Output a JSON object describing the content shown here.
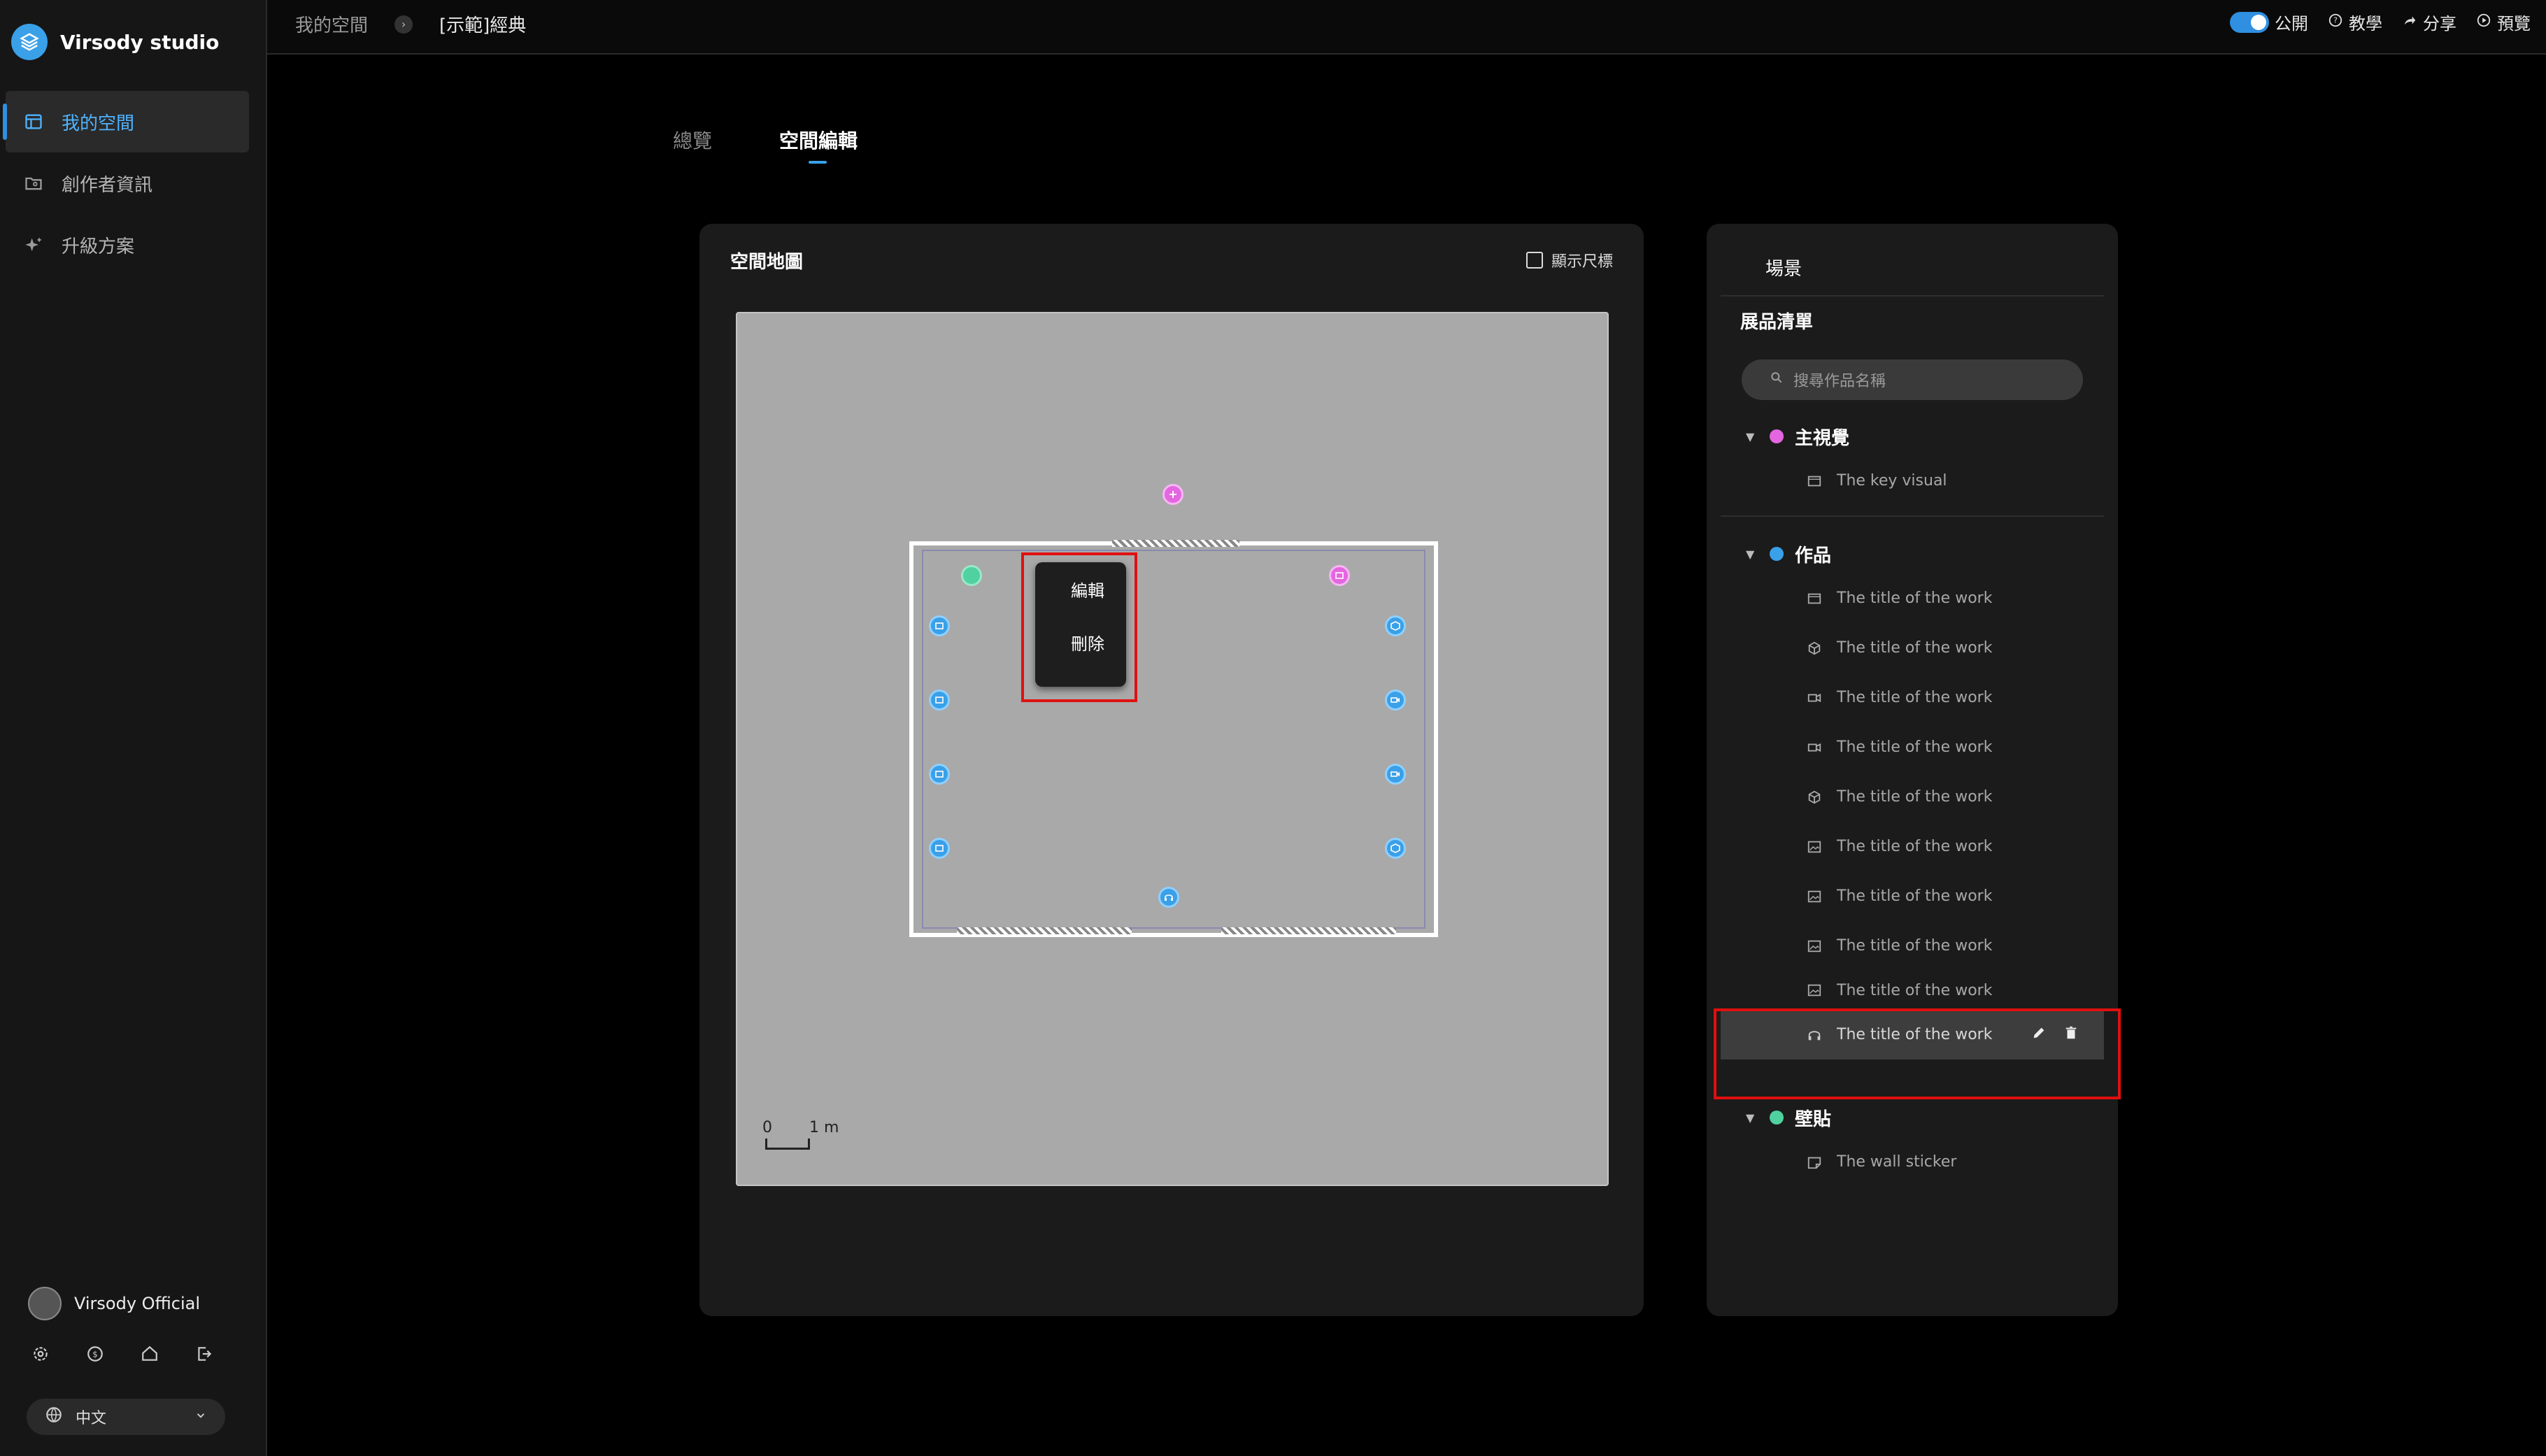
{
  "app": {
    "name": "Virsody studio"
  },
  "sidebar": {
    "items": [
      {
        "label": "我的空間",
        "icon": "layout-icon",
        "active": true
      },
      {
        "label": "創作者資訊",
        "icon": "folder-user-icon",
        "active": false
      },
      {
        "label": "升級方案",
        "icon": "sparkle-icon",
        "active": false
      }
    ],
    "user_name": "Virsody Official",
    "bottom_icons": [
      "settings-icon",
      "billing-icon",
      "home-icon",
      "logout-icon"
    ],
    "language": "中文"
  },
  "topbar": {
    "breadcrumb": [
      "我的空間",
      "[示範]經典"
    ],
    "public_label": "公開",
    "tutorial_label": "教學",
    "share_label": "分享",
    "preview_label": "預覽",
    "public_enabled": true
  },
  "tabs": [
    {
      "label": "總覽",
      "active": false
    },
    {
      "label": "空間編輯",
      "active": true
    }
  ],
  "map": {
    "title": "空間地圖",
    "show_ruler_label": "顯示尺標",
    "show_ruler_checked": false,
    "scale_zero": "0",
    "scale_one": "1",
    "scale_unit": "m",
    "context_menu": {
      "edit_label": "編輯",
      "delete_label": "刪除"
    }
  },
  "side": {
    "scene_label": "場景",
    "list_title": "展品清單",
    "search_placeholder": "搜尋作品名稱",
    "groups": [
      {
        "name": "主視覺",
        "color": "#e466e0",
        "items": [
          {
            "title": "The key visual",
            "icon": "image-frame-icon"
          }
        ]
      },
      {
        "name": "作品",
        "color": "#3aa0e8",
        "items": [
          {
            "title": "The title of the work",
            "icon": "image-frame-icon"
          },
          {
            "title": "The title of the work",
            "icon": "cube-icon"
          },
          {
            "title": "The title of the work",
            "icon": "video-icon"
          },
          {
            "title": "The title of the work",
            "icon": "video-icon"
          },
          {
            "title": "The title of the work",
            "icon": "cube-icon"
          },
          {
            "title": "The title of the work",
            "icon": "image-icon"
          },
          {
            "title": "The title of the work",
            "icon": "image-icon"
          },
          {
            "title": "The title of the work",
            "icon": "image-icon"
          },
          {
            "title": "The title of the work",
            "icon": "image-icon"
          },
          {
            "title": "The title of the work",
            "icon": "headphones-icon",
            "selected": true
          }
        ]
      },
      {
        "name": "壁貼",
        "color": "#4fd1a0",
        "items": [
          {
            "title": "The wall sticker",
            "icon": "sticker-icon"
          }
        ]
      }
    ]
  },
  "colors": {
    "accent": "#3aa0e8",
    "highlight": "#e01010",
    "visual": "#e466e0",
    "sticker": "#4fd1a0"
  }
}
